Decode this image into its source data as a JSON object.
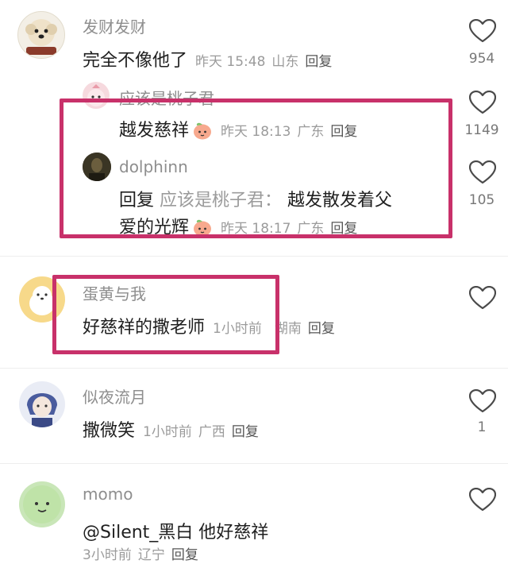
{
  "comments": [
    {
      "username": "发财发财",
      "text": "完全不像他了",
      "time": "昨天 15:48",
      "location": "山东",
      "reply_label": "回复",
      "likes": "954"
    },
    {
      "username": "应该是桃子君",
      "text": "越发慈祥",
      "time": "昨天 18:13",
      "location": "广东",
      "reply_label": "回复",
      "likes": "1149"
    },
    {
      "username": "dolphinn",
      "reply_prefix": "回复",
      "quoted_user": "应该是桃子君：",
      "text_line1": "越发散发着父",
      "text_line2": "爱的光辉",
      "time": "昨天 18:17",
      "location": "广东",
      "reply_label": "回复",
      "likes": "105"
    },
    {
      "username": "蛋黄与我",
      "text": "好慈祥的撒老师",
      "time": "1小时前",
      "location": "湖南",
      "reply_label": "回复",
      "likes": ""
    },
    {
      "username": "似夜流月",
      "text": "撒微笑",
      "time": "1小时前",
      "location": "广西",
      "reply_label": "回复",
      "likes": "1"
    },
    {
      "username": "momo",
      "text": "@Silent_黑白 他好慈祥",
      "time": "3小时前",
      "location": "辽宁",
      "reply_label": "回复",
      "likes": ""
    }
  ],
  "colors": {
    "highlight": "#c8316a",
    "meta_text": "#9b9b9b"
  }
}
